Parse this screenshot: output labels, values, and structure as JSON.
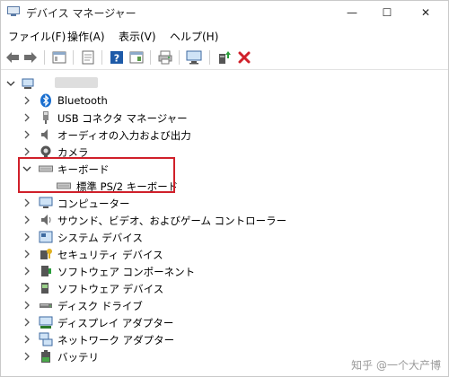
{
  "window": {
    "title": "デバイス マネージャー",
    "controls": {
      "minimize": "—",
      "maximize": "☐",
      "close": "✕"
    }
  },
  "menubar": {
    "items": [
      {
        "label": "ファイル(F)"
      },
      {
        "label": "操作(A)"
      },
      {
        "label": "表示(V)"
      },
      {
        "label": "ヘルプ(H)"
      }
    ]
  },
  "toolbar": {
    "buttons": [
      "back-icon",
      "forward-icon",
      "properties-icon",
      "driver-icon",
      "help-icon",
      "view-icon",
      "print-icon",
      "monitor-icon",
      "update-driver-icon",
      "uninstall-icon"
    ]
  },
  "tree": {
    "root": {
      "label": ""
    },
    "items": [
      {
        "label": "Bluetooth",
        "icon": "bluetooth-icon",
        "expanded": false
      },
      {
        "label": "USB コネクタ マネージャー",
        "icon": "usb-icon",
        "expanded": false
      },
      {
        "label": "オーディオの入力および出力",
        "icon": "audio-icon",
        "expanded": false
      },
      {
        "label": "カメラ",
        "icon": "camera-icon",
        "expanded": false
      },
      {
        "label": "キーボード",
        "icon": "keyboard-icon",
        "expanded": true
      },
      {
        "label": "標準 PS/2 キーボード",
        "icon": "keyboard-icon",
        "child": true
      },
      {
        "label": "コンピューター",
        "icon": "computer-icon",
        "expanded": false
      },
      {
        "label": "サウンド、ビデオ、およびゲーム コントローラー",
        "icon": "speaker-icon",
        "expanded": false
      },
      {
        "label": "システム デバイス",
        "icon": "system-icon",
        "expanded": false
      },
      {
        "label": "セキュリティ デバイス",
        "icon": "security-icon",
        "expanded": false
      },
      {
        "label": "ソフトウェア コンポーネント",
        "icon": "component-icon",
        "expanded": false
      },
      {
        "label": "ソフトウェア デバイス",
        "icon": "software-icon",
        "expanded": false
      },
      {
        "label": "ディスク ドライブ",
        "icon": "disk-icon",
        "expanded": false
      },
      {
        "label": "ディスプレイ アダプター",
        "icon": "display-icon",
        "expanded": false
      },
      {
        "label": "ネットワーク アダプター",
        "icon": "network-icon",
        "expanded": false
      },
      {
        "label": "バッテリ",
        "icon": "battery-icon",
        "expanded": false
      }
    ]
  },
  "watermark": "知乎 @一个大产博",
  "colors": {
    "highlight": "#d0202a",
    "accent": "#1a73c8"
  }
}
